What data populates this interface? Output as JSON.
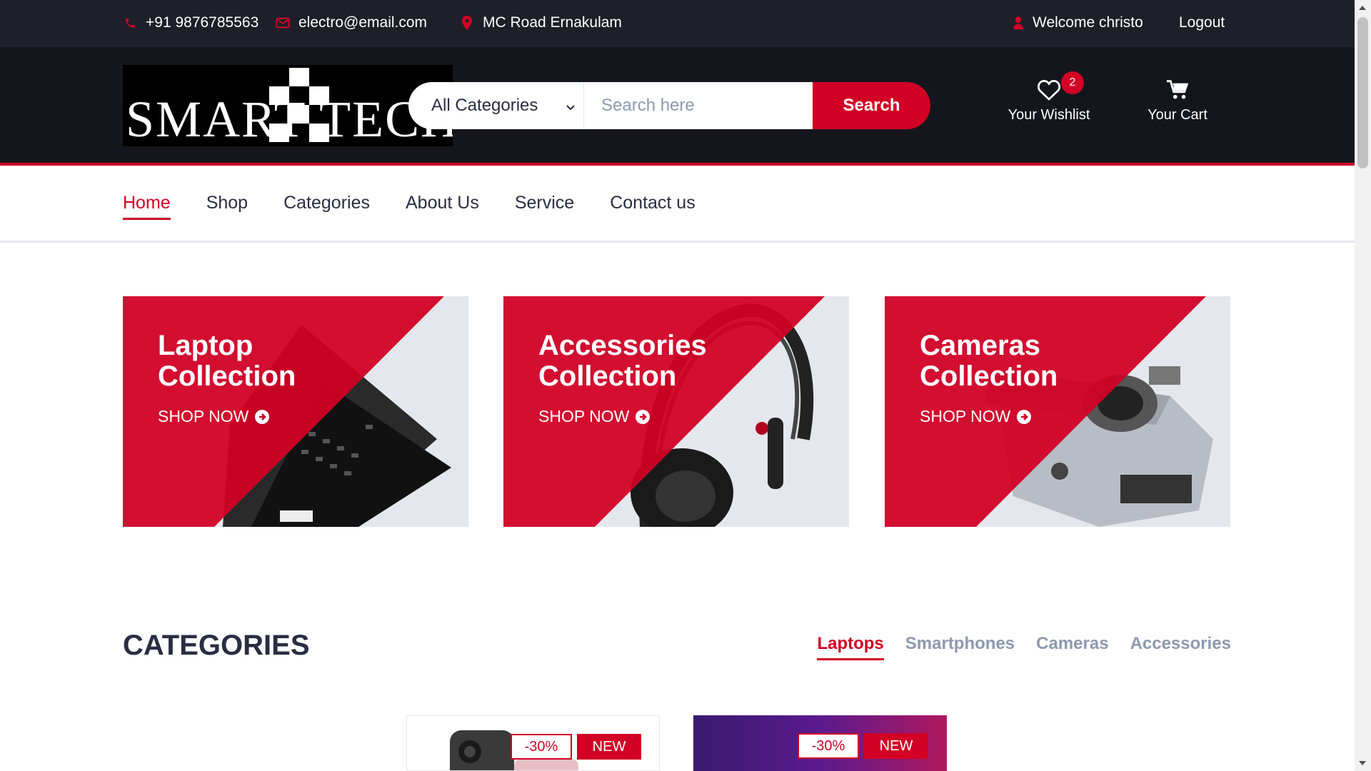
{
  "topbar": {
    "phone": "+91 9876785563",
    "email": "electro@email.com",
    "location": "MC Road Ernakulam",
    "welcome": "Welcome christo",
    "logout": "Logout"
  },
  "header": {
    "logo_text": "SMART TECH",
    "category_select": "All Categories",
    "search_placeholder": "Search here",
    "search_button": "Search",
    "wishlist_label": "Your Wishlist",
    "wishlist_count": "2",
    "cart_label": "Your Cart"
  },
  "nav": {
    "items": [
      "Home",
      "Shop",
      "Categories",
      "About Us",
      "Service",
      "Contact us"
    ],
    "active": "Home"
  },
  "collections": [
    {
      "title_line1": "Laptop",
      "title_line2": "Collection",
      "cta": "SHOP NOW"
    },
    {
      "title_line1": "Accessories",
      "title_line2": "Collection",
      "cta": "SHOP NOW"
    },
    {
      "title_line1": "Cameras",
      "title_line2": "Collection",
      "cta": "SHOP NOW"
    }
  ],
  "categories": {
    "title": "CATEGORIES",
    "tabs": [
      "Laptops",
      "Smartphones",
      "Cameras",
      "Accessories"
    ],
    "active_tab": "Laptops"
  },
  "products": [
    {
      "sale": "-30%",
      "badge": "NEW"
    },
    {
      "sale": "-30%",
      "badge": "NEW"
    }
  ],
  "colors": {
    "accent": "#d10024",
    "topbar_bg": "#1e1f29",
    "header_bg": "#15161d",
    "muted": "#8d99ae"
  },
  "icons": [
    "phone-icon",
    "envelope-icon",
    "map-marker-icon",
    "user-icon",
    "heart-icon",
    "shopping-cart-icon",
    "chevron-down-icon",
    "arrow-circle-right-icon"
  ]
}
